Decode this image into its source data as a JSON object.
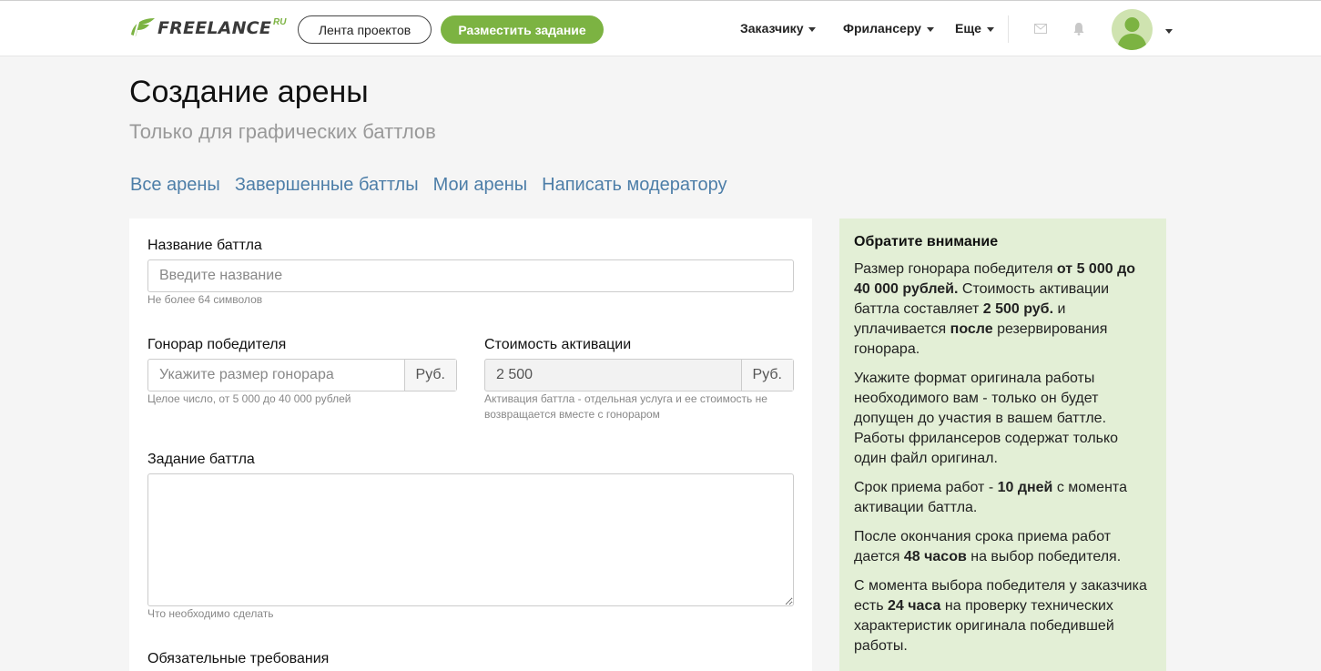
{
  "header": {
    "logo_text": "FREELANCE",
    "logo_sup": "RU",
    "feed_button": "Лента проектов",
    "post_button": "Разместить задание",
    "menu": [
      "Заказчику",
      "Фрилансеру",
      "Еще"
    ],
    "brand_color": "#7cb342"
  },
  "page": {
    "title": "Создание арены",
    "subtitle": "Только для графических баттлов",
    "tabs": [
      "Все арены",
      "Завершенные баттлы",
      "Мои арены",
      "Написать модератору"
    ]
  },
  "form": {
    "name_label": "Название баттла",
    "name_placeholder": "Введите название",
    "name_hint": "Не более 64 символов",
    "fee_label": "Гонорар победителя",
    "fee_placeholder": "Укажите размер гонорара",
    "fee_unit": "Руб.",
    "fee_hint": "Целое число, от 5 000 до 40 000 рублей",
    "activation_label": "Стоимость активации",
    "activation_value": "2 500",
    "activation_unit": "Руб.",
    "activation_hint_1": "Активация баттла - отдельная услуга и ее стоимость не",
    "activation_hint_2": "возвращается вместе с гонораром",
    "task_label": "Задание баттла",
    "task_hint": "Что необходимо сделать",
    "requirements_label": "Обязательные требования"
  },
  "notice": {
    "title": "Обратите внимание",
    "p1_a": "Размер гонорара победителя ",
    "p1_b": "от 5 000 до 40 000 рублей.",
    "p1_c": " Стоимость активации баттла составляет ",
    "p1_d": "2 500 руб.",
    "p1_e": " и уплачивается ",
    "p1_f": "после",
    "p1_g": " резервирования гонорара.",
    "p2": "Укажите формат оригинала работы необходимого вам - только он будет допущен до участия в вашем баттле. Работы фрилансеров содержат только один файл оригинал.",
    "p3_a": "Срок приема работ - ",
    "p3_b": "10 дней",
    "p3_c": " с момента активации баттла.",
    "p4_a": "После окончания срока приема работ дается ",
    "p4_b": "48 часов",
    "p4_c": " на выбор победителя.",
    "p5_a": "С момента выбора победителя у заказчика есть ",
    "p5_b": "24 часа",
    "p5_c": " на проверку технических характеристик оригинала победившей работы."
  }
}
